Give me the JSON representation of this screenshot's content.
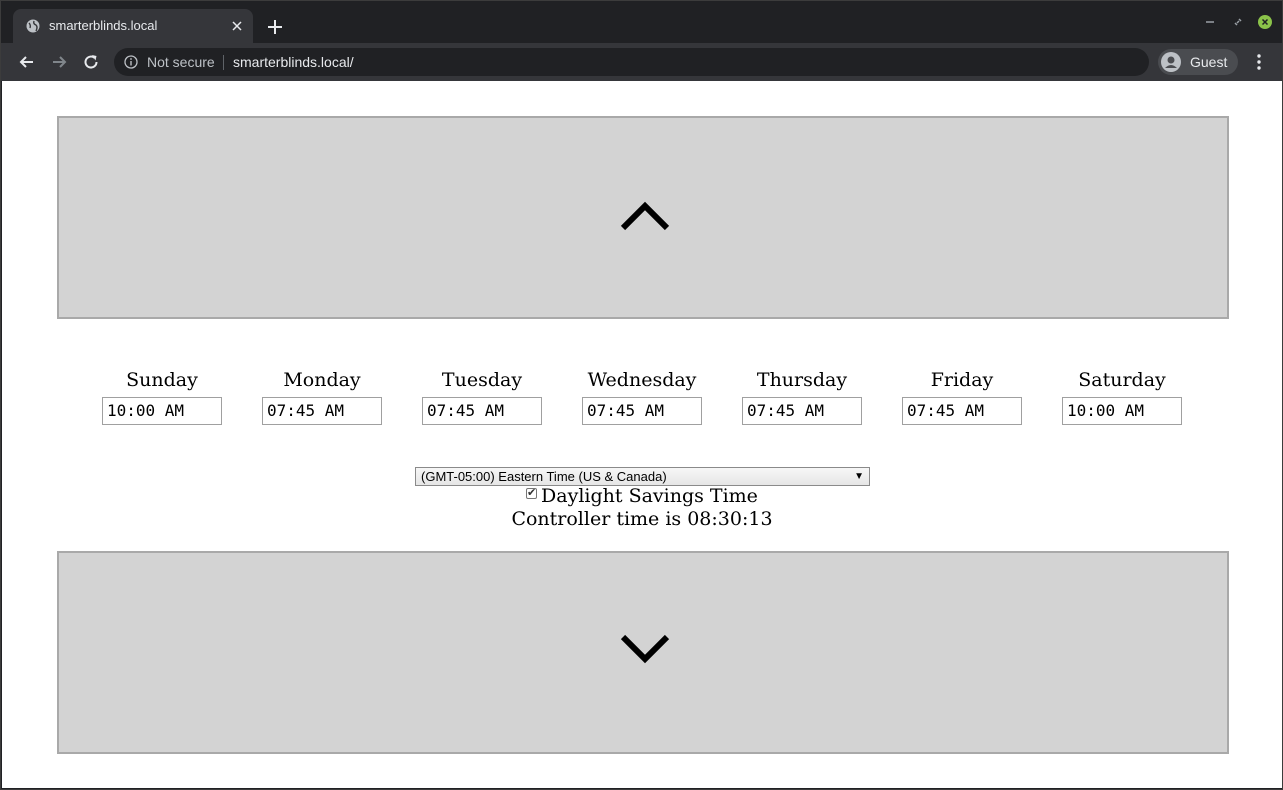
{
  "browser": {
    "tab_title": "smarterblinds.local",
    "security_label": "Not secure",
    "url": "smarterblinds.local/",
    "profile_name": "Guest"
  },
  "controls": {
    "up_button_icon": "chevron-up-icon",
    "down_button_icon": "chevron-down-icon"
  },
  "schedule": {
    "days": [
      {
        "label": "Sunday",
        "time": "10:00 AM"
      },
      {
        "label": "Monday",
        "time": "07:45 AM"
      },
      {
        "label": "Tuesday",
        "time": "07:45 AM"
      },
      {
        "label": "Wednesday",
        "time": "07:45 AM"
      },
      {
        "label": "Thursday",
        "time": "07:45 AM"
      },
      {
        "label": "Friday",
        "time": "07:45 AM"
      },
      {
        "label": "Saturday",
        "time": "10:00 AM"
      }
    ]
  },
  "settings": {
    "timezone": "(GMT-05:00) Eastern Time (US & Canada)",
    "dst_label": "Daylight Savings Time",
    "dst_checked": true,
    "controller_time_text": "Controller time is 08:30:13"
  },
  "colors": {
    "button_bg": "#d3d3d3",
    "button_border": "#a9a9a9",
    "chrome_dark": "#202124",
    "chrome_toolbar": "#35363a"
  }
}
